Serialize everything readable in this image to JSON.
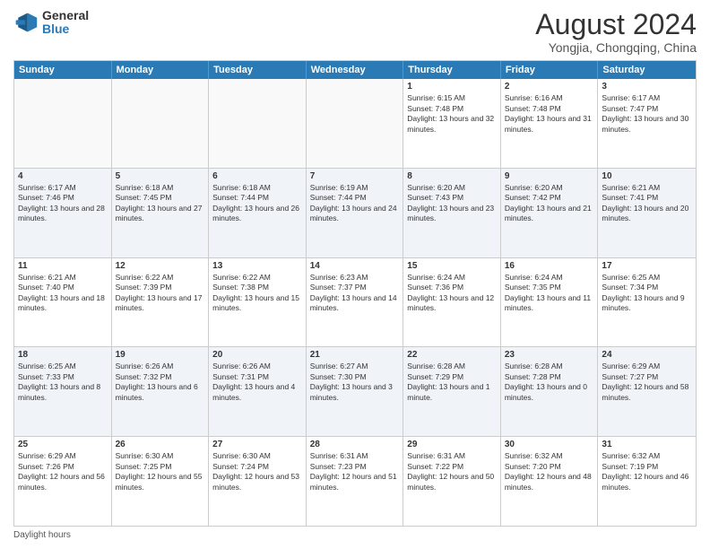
{
  "logo": {
    "line1": "General",
    "line2": "Blue"
  },
  "title": "August 2024",
  "subtitle": "Yongjia, Chongqing, China",
  "days": [
    "Sunday",
    "Monday",
    "Tuesday",
    "Wednesday",
    "Thursday",
    "Friday",
    "Saturday"
  ],
  "footer": "Daylight hours",
  "weeks": [
    [
      {
        "day": "",
        "content": ""
      },
      {
        "day": "",
        "content": ""
      },
      {
        "day": "",
        "content": ""
      },
      {
        "day": "",
        "content": ""
      },
      {
        "day": "1",
        "content": "Sunrise: 6:15 AM\nSunset: 7:48 PM\nDaylight: 13 hours and 32 minutes."
      },
      {
        "day": "2",
        "content": "Sunrise: 6:16 AM\nSunset: 7:48 PM\nDaylight: 13 hours and 31 minutes."
      },
      {
        "day": "3",
        "content": "Sunrise: 6:17 AM\nSunset: 7:47 PM\nDaylight: 13 hours and 30 minutes."
      }
    ],
    [
      {
        "day": "4",
        "content": "Sunrise: 6:17 AM\nSunset: 7:46 PM\nDaylight: 13 hours and 28 minutes."
      },
      {
        "day": "5",
        "content": "Sunrise: 6:18 AM\nSunset: 7:45 PM\nDaylight: 13 hours and 27 minutes."
      },
      {
        "day": "6",
        "content": "Sunrise: 6:18 AM\nSunset: 7:44 PM\nDaylight: 13 hours and 26 minutes."
      },
      {
        "day": "7",
        "content": "Sunrise: 6:19 AM\nSunset: 7:44 PM\nDaylight: 13 hours and 24 minutes."
      },
      {
        "day": "8",
        "content": "Sunrise: 6:20 AM\nSunset: 7:43 PM\nDaylight: 13 hours and 23 minutes."
      },
      {
        "day": "9",
        "content": "Sunrise: 6:20 AM\nSunset: 7:42 PM\nDaylight: 13 hours and 21 minutes."
      },
      {
        "day": "10",
        "content": "Sunrise: 6:21 AM\nSunset: 7:41 PM\nDaylight: 13 hours and 20 minutes."
      }
    ],
    [
      {
        "day": "11",
        "content": "Sunrise: 6:21 AM\nSunset: 7:40 PM\nDaylight: 13 hours and 18 minutes."
      },
      {
        "day": "12",
        "content": "Sunrise: 6:22 AM\nSunset: 7:39 PM\nDaylight: 13 hours and 17 minutes."
      },
      {
        "day": "13",
        "content": "Sunrise: 6:22 AM\nSunset: 7:38 PM\nDaylight: 13 hours and 15 minutes."
      },
      {
        "day": "14",
        "content": "Sunrise: 6:23 AM\nSunset: 7:37 PM\nDaylight: 13 hours and 14 minutes."
      },
      {
        "day": "15",
        "content": "Sunrise: 6:24 AM\nSunset: 7:36 PM\nDaylight: 13 hours and 12 minutes."
      },
      {
        "day": "16",
        "content": "Sunrise: 6:24 AM\nSunset: 7:35 PM\nDaylight: 13 hours and 11 minutes."
      },
      {
        "day": "17",
        "content": "Sunrise: 6:25 AM\nSunset: 7:34 PM\nDaylight: 13 hours and 9 minutes."
      }
    ],
    [
      {
        "day": "18",
        "content": "Sunrise: 6:25 AM\nSunset: 7:33 PM\nDaylight: 13 hours and 8 minutes."
      },
      {
        "day": "19",
        "content": "Sunrise: 6:26 AM\nSunset: 7:32 PM\nDaylight: 13 hours and 6 minutes."
      },
      {
        "day": "20",
        "content": "Sunrise: 6:26 AM\nSunset: 7:31 PM\nDaylight: 13 hours and 4 minutes."
      },
      {
        "day": "21",
        "content": "Sunrise: 6:27 AM\nSunset: 7:30 PM\nDaylight: 13 hours and 3 minutes."
      },
      {
        "day": "22",
        "content": "Sunrise: 6:28 AM\nSunset: 7:29 PM\nDaylight: 13 hours and 1 minute."
      },
      {
        "day": "23",
        "content": "Sunrise: 6:28 AM\nSunset: 7:28 PM\nDaylight: 13 hours and 0 minutes."
      },
      {
        "day": "24",
        "content": "Sunrise: 6:29 AM\nSunset: 7:27 PM\nDaylight: 12 hours and 58 minutes."
      }
    ],
    [
      {
        "day": "25",
        "content": "Sunrise: 6:29 AM\nSunset: 7:26 PM\nDaylight: 12 hours and 56 minutes."
      },
      {
        "day": "26",
        "content": "Sunrise: 6:30 AM\nSunset: 7:25 PM\nDaylight: 12 hours and 55 minutes."
      },
      {
        "day": "27",
        "content": "Sunrise: 6:30 AM\nSunset: 7:24 PM\nDaylight: 12 hours and 53 minutes."
      },
      {
        "day": "28",
        "content": "Sunrise: 6:31 AM\nSunset: 7:23 PM\nDaylight: 12 hours and 51 minutes."
      },
      {
        "day": "29",
        "content": "Sunrise: 6:31 AM\nSunset: 7:22 PM\nDaylight: 12 hours and 50 minutes."
      },
      {
        "day": "30",
        "content": "Sunrise: 6:32 AM\nSunset: 7:20 PM\nDaylight: 12 hours and 48 minutes."
      },
      {
        "day": "31",
        "content": "Sunrise: 6:32 AM\nSunset: 7:19 PM\nDaylight: 12 hours and 46 minutes."
      }
    ]
  ]
}
